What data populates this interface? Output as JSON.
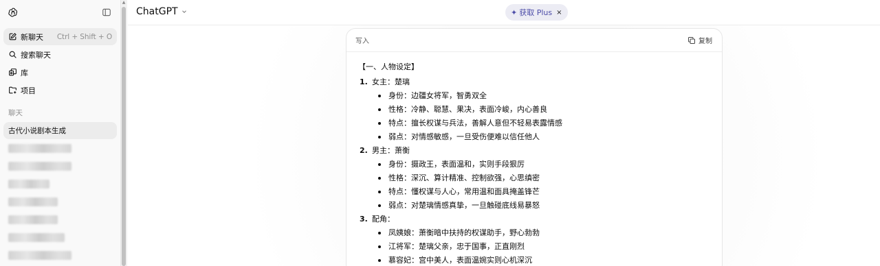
{
  "sidebar": {
    "nav": [
      {
        "label": "新聊天",
        "shortcut": "Ctrl + Shift + O",
        "icon": "new-chat-icon"
      },
      {
        "label": "搜索聊天",
        "icon": "search-icon"
      },
      {
        "label": "库",
        "icon": "library-icon"
      },
      {
        "label": "项目",
        "icon": "folder-icon"
      }
    ],
    "section_label": "聊天",
    "chats": [
      {
        "label": "古代小说剧本生成"
      }
    ]
  },
  "header": {
    "model_name": "ChatGPT",
    "plus_label": "获取 Plus",
    "close_glyph": "×"
  },
  "canvas": {
    "title": "写入",
    "copy_label": "复制",
    "heading": "【一、人物设定】",
    "items": [
      {
        "num": "1.",
        "title": "女主：楚璃",
        "details": [
          "身份：边疆女将军，智勇双全",
          "性格：冷静、聪慧、果决，表面冷峻，内心善良",
          "特点：擅长权谋与兵法，善解人意但不轻易表露情感",
          "弱点：对情感敏感，一旦受伤便难以信任他人"
        ]
      },
      {
        "num": "2.",
        "title": "男主：萧衡",
        "details": [
          "身份：摄政王，表面温和，实则手段狠厉",
          "性格：深沉、算计精准、控制欲强，心思缜密",
          "特点：懂权谋与人心，常用温和面具掩盖锋芒",
          "弱点：对楚璃情感真挚，一旦触碰底线易暴怒"
        ]
      },
      {
        "num": "3.",
        "title": "配角：",
        "details": [
          "凤姨娘：萧衡暗中扶持的权谋助手，野心勃勃",
          "江将军：楚璃父亲，忠于国事，正直刚烈",
          "慕容妃：宫中美人，表面温婉实则心机深沉"
        ]
      }
    ]
  }
}
